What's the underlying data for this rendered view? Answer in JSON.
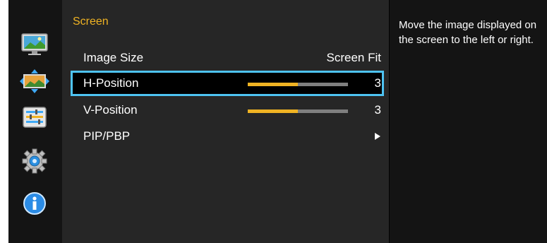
{
  "menu": {
    "title": "Screen",
    "items": [
      {
        "label": "Image Size",
        "value": "Screen Fit"
      },
      {
        "label": "H-Position",
        "value": "3",
        "level_percent": 50
      },
      {
        "label": "V-Position",
        "value": "3",
        "level_percent": 50
      },
      {
        "label": "PIP/PBP",
        "value": ""
      }
    ],
    "selected_index": 1
  },
  "help": {
    "text": "Move the image displayed on the screen to the left or right."
  },
  "sidebar": {
    "icons": [
      "picture-icon",
      "screen-position-icon",
      "settings-sliders-icon",
      "gear-icon",
      "info-icon"
    ],
    "selected": "screen-position-icon"
  },
  "colors": {
    "accent": "#f0b323",
    "selection_border": "#4ec3f2",
    "panel_bg": "#262626",
    "sidebar_bg": "#141414"
  }
}
